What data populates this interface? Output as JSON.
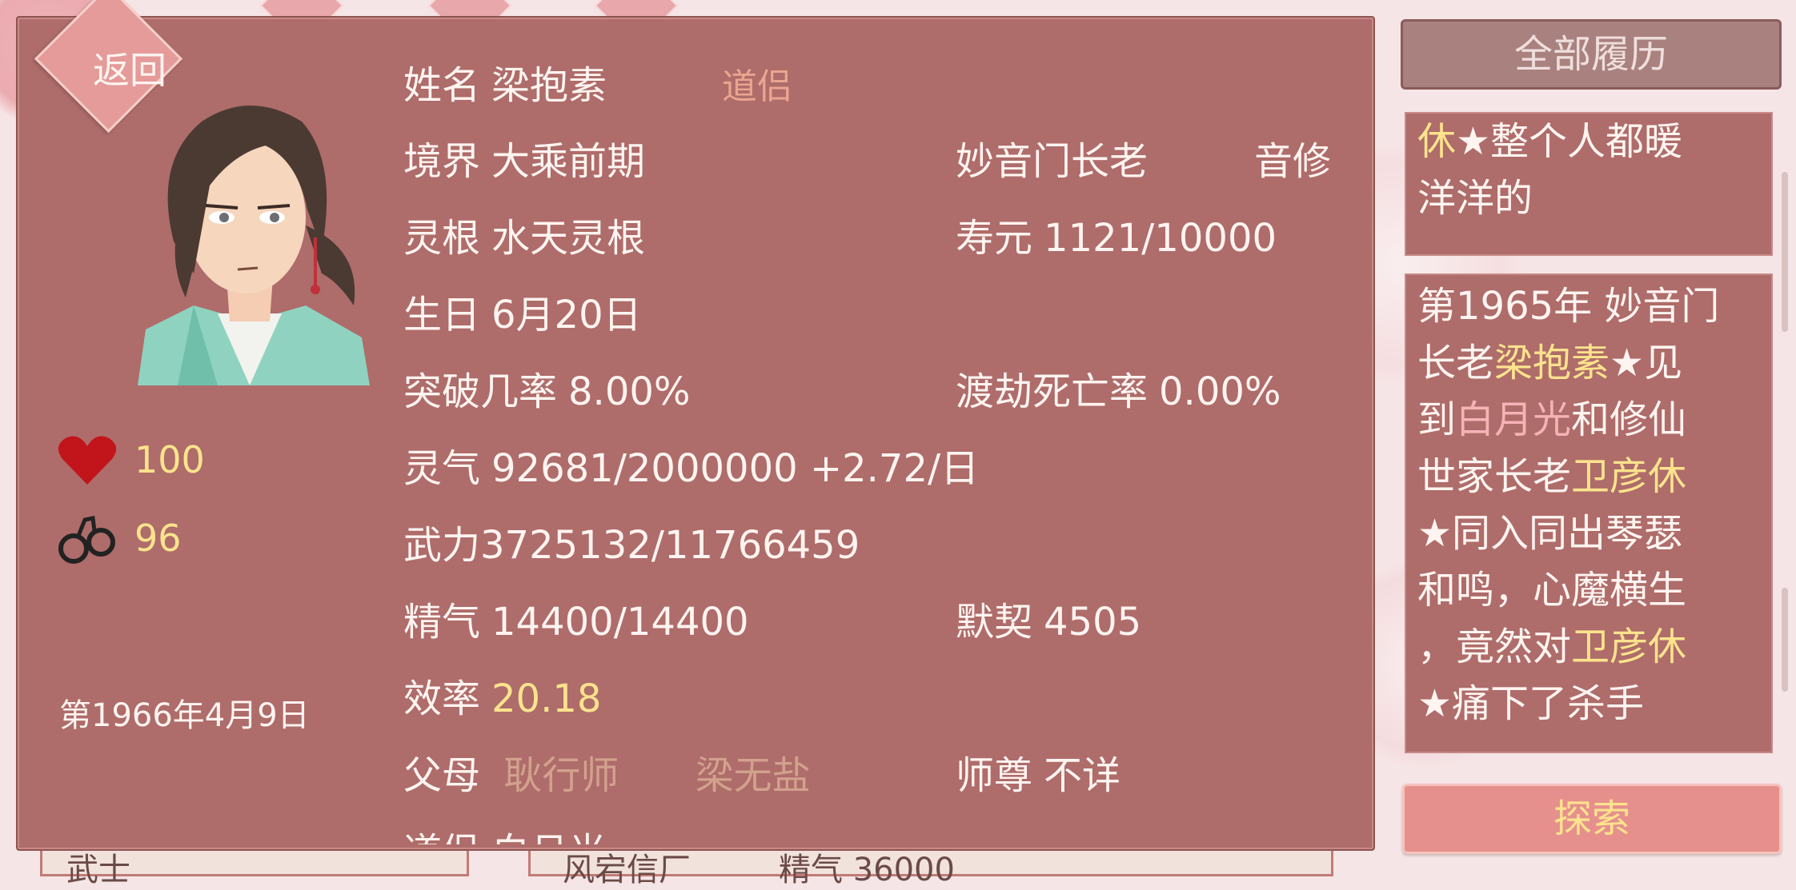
{
  "back_label": "返回",
  "hearts": "100",
  "cuffs": "96",
  "date": "第1966年4月9日",
  "name_label": "姓名",
  "name": "梁抱素",
  "relation": "道侣",
  "realm_label": "境界",
  "realm": "大乘前期",
  "position": "妙音门长老",
  "cultivation_type": "音修",
  "root_label": "灵根",
  "root": "水天灵根",
  "lifespan_label": "寿元",
  "lifespan": "1121/10000",
  "birthday_label": "生日",
  "birthday": "6月20日",
  "breakthrough_label": "突破几率",
  "breakthrough": "8.00%",
  "tribulation_label": "渡劫死亡率",
  "tribulation": "0.00%",
  "qi_label": "灵气",
  "qi": "92681/2000000 +2.72/日",
  "force": "武力3725132/11766459",
  "essence_label": "精气",
  "essence": "14400/14400",
  "tacit_label": "默契",
  "tacit": "4505",
  "efficiency_label": "效率",
  "efficiency": "20.18",
  "parents_label": "父母",
  "parent1": "耿行师",
  "parent2": "梁无盐",
  "master_label": "师尊",
  "master": "不详",
  "partner_label": "道侣",
  "partner": "白月光",
  "bottom_left": "武士",
  "bottom_mid": "风宕信厂",
  "bottom_right": "精气 36000",
  "history_btn": "全部履历",
  "log1": {
    "p1": "休",
    "p2": "★整个人都暖",
    "p3": "洋洋的"
  },
  "log2": {
    "l1": "第1965年 妙音门",
    "l2a": "长老",
    "l2b": "梁抱素",
    "l2c": "★见",
    "l3a": "到",
    "l3b": "白月光",
    "l3c": "和修仙",
    "l4a": "世家长老",
    "l4b": "卫彦休",
    "l5": "★同入同出琴瑟",
    "l6": "和鸣，心魔横生",
    "l7a": "，竟然对",
    "l7b": "卫彦休",
    "l8": "★痛下了杀手"
  },
  "explore_btn": "探索",
  "colors": {
    "panel": "#ae6c6a",
    "gold": "#fde38d",
    "pink_name": "#f7b2b6",
    "muted": "#e9a58f"
  }
}
